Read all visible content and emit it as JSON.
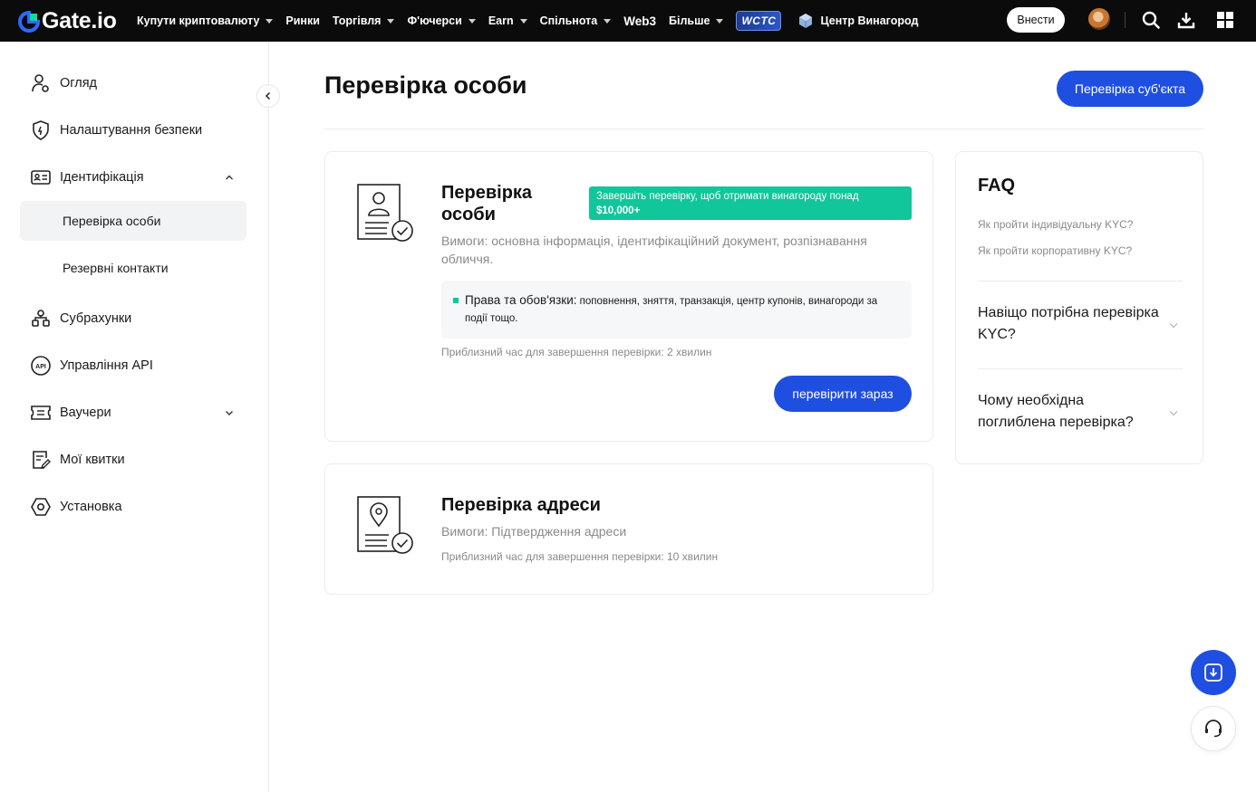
{
  "brand": {
    "name": "Gate.io",
    "accent": "#1f4fe0",
    "success": "#10c69a"
  },
  "topnav": {
    "items": [
      {
        "label": "Купути криптовалюту",
        "caret": true
      },
      {
        "label": "Ринки",
        "caret": false
      },
      {
        "label": "Торгівля",
        "caret": true
      },
      {
        "label": "Ф'ючерси",
        "caret": true
      },
      {
        "label": "Earn",
        "caret": true
      },
      {
        "label": "Спільнота",
        "caret": true
      },
      {
        "label": "Web3",
        "caret": false
      },
      {
        "label": "Більше",
        "caret": true
      }
    ],
    "wctc_label": "WCTC",
    "rewards_label": "Центр Винагород",
    "login_label": "Внести",
    "icons": [
      "avatar",
      "search-icon",
      "download-icon",
      "grid-icon"
    ]
  },
  "sidebar": {
    "items": [
      {
        "label": "Огляд",
        "icon": "user-overview-icon"
      },
      {
        "label": "Налаштування безпеки",
        "icon": "shield-icon"
      },
      {
        "label": "Ідентифікація",
        "icon": "id-card-icon",
        "expanded": true
      },
      {
        "label": "Перевірка особи",
        "sub": true,
        "active": true
      },
      {
        "label": "Резервні контакти",
        "sub": true
      },
      {
        "label": "Субрахунки",
        "icon": "subaccounts-icon"
      },
      {
        "label": "Управління API",
        "icon": "api-icon"
      },
      {
        "label": "Ваучери",
        "icon": "voucher-icon",
        "expandable": true
      },
      {
        "label": "Мої квитки",
        "icon": "ticket-icon"
      },
      {
        "label": "Установка",
        "icon": "settings-icon"
      }
    ]
  },
  "main": {
    "title": "Перевірка особи",
    "entity_button": "Перевірка суб'єкта",
    "identity_card": {
      "title_line1": "Перевірка",
      "title_line2": "особи",
      "promo_line1": "Завершіть перевірку, щоб отримати винагороду понад",
      "promo_line2": "$10,000+",
      "requirements_line1": "Вимоги: основна інформація, ідентифікаційний документ, розпізнавання",
      "requirements_line2": "обличчя.",
      "rights_strong": "Права та обов'язки:",
      "rights_text": " поповнення, зняття, транзакція, центр купонів, винагороди за",
      "rights_text2": "події тощо.",
      "time": "Приблизний час для завершення перевірки: 2 хвилин",
      "button": "перевірити зараз"
    },
    "address_card": {
      "title": "Перевірка адреси",
      "requirements": "Вимоги: Підтвердження адреси",
      "time": "Приблизний час для завершення перевірки: 10 хвилин"
    }
  },
  "faq": {
    "title": "FAQ",
    "links": [
      "Як пройти індивідуальну KYC?",
      "Як пройти корпоративну KYC?"
    ],
    "questions": [
      {
        "line1": "Навіщо потрібна перевірка",
        "line2": "KYC?"
      },
      {
        "line1": "Чому необхідна",
        "line2": "поглиблена перевірка?"
      }
    ]
  }
}
